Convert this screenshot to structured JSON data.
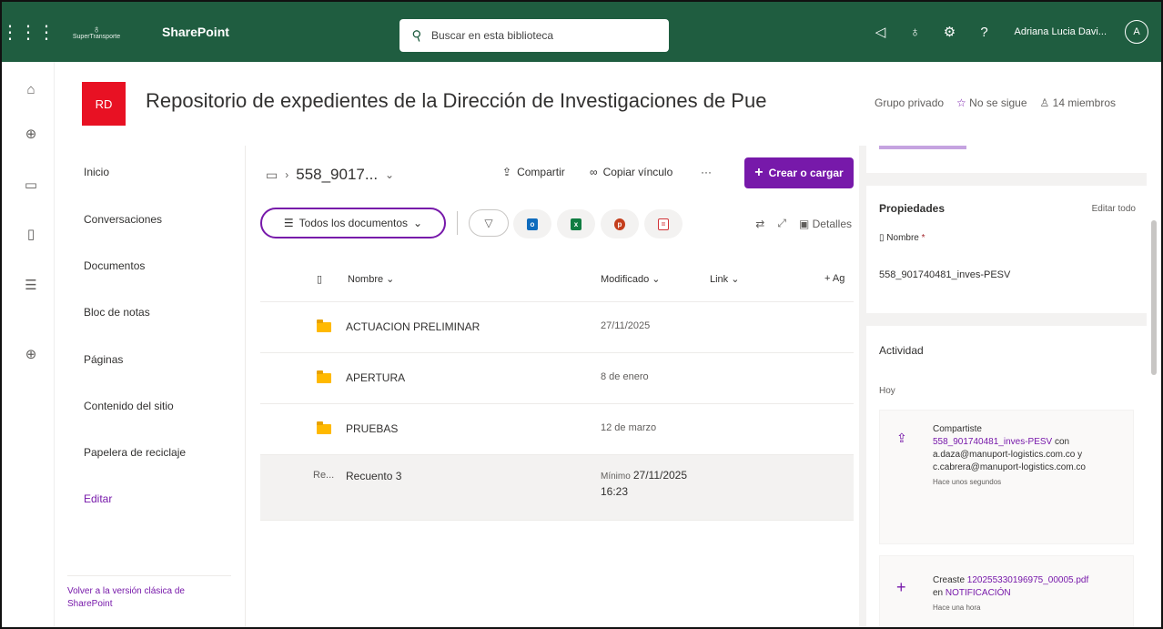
{
  "suite": {
    "brand_name": "SuperTransporte",
    "app_name": "SharePoint",
    "search_placeholder": "Buscar en esta biblioteca",
    "user_name": "Adriana Lucia Davi...",
    "user_initial": "A"
  },
  "site": {
    "logo_text": "RD",
    "title": "Repositorio de expedientes de la Dirección de Investigaciones de Pue",
    "privacy": "Grupo privado",
    "follow": "No se sigue",
    "members": "14 miembros"
  },
  "nav": {
    "items": [
      "Inicio",
      "Conversaciones",
      "Documentos",
      "Bloc de notas",
      "Páginas",
      "Contenido del sitio",
      "Papelera de reciclaje"
    ],
    "edit": "Editar",
    "classic": "Volver a la versión clásica de SharePoint"
  },
  "library": {
    "breadcrumb": "558_9017...",
    "share": "Compartir",
    "copy_link": "Copiar vínculo",
    "more": "···",
    "create": "Crear o cargar",
    "view": "Todos los documentos",
    "details": "Detalles",
    "columns": {
      "name": "Nombre",
      "modified": "Modificado",
      "link": "Link",
      "add": "+ Ag"
    },
    "rows": [
      {
        "name": "ACTUACION PRELIMINAR",
        "modified": "27/11/2025"
      },
      {
        "name": "APERTURA",
        "modified": "8 de enero"
      },
      {
        "name": "PRUEBAS",
        "modified": "12 de marzo"
      }
    ],
    "selected_row": {
      "prefix": "Re...",
      "name": "Recuento 3",
      "modified_label": "Mínimo",
      "modified_date": "27/11/2025",
      "modified_time": "16:23"
    }
  },
  "details": {
    "properties_title": "Propiedades",
    "edit_all": "Editar todo",
    "name_label": "Nombre",
    "required_mark": "*",
    "name_value": "558_901740481_inves-PESV",
    "activity_title": "Actividad",
    "today": "Hoy",
    "activity": [
      {
        "verb": "Compartiste",
        "link": "558_901740481_inves-PESV",
        "middle": "con",
        "rest": "a.daza@manuport-logistics.com.co y c.cabrera@manuport-logistics.com.co",
        "time": "Hace unos segundos"
      },
      {
        "verb": "Creaste",
        "link": "120255330196975_00005.pdf",
        "middle": "en",
        "rest": "NOTIFICACIÓN",
        "time": "Hace una hora"
      }
    ]
  },
  "colors": {
    "suite_bar": "#1f5d40",
    "accent": "#7719aa",
    "site_logo": "#e81123",
    "folder": "#ffb900"
  },
  "icons": {
    "outlook": "o",
    "excel": "x",
    "powerpoint": "p",
    "pdf": "="
  }
}
